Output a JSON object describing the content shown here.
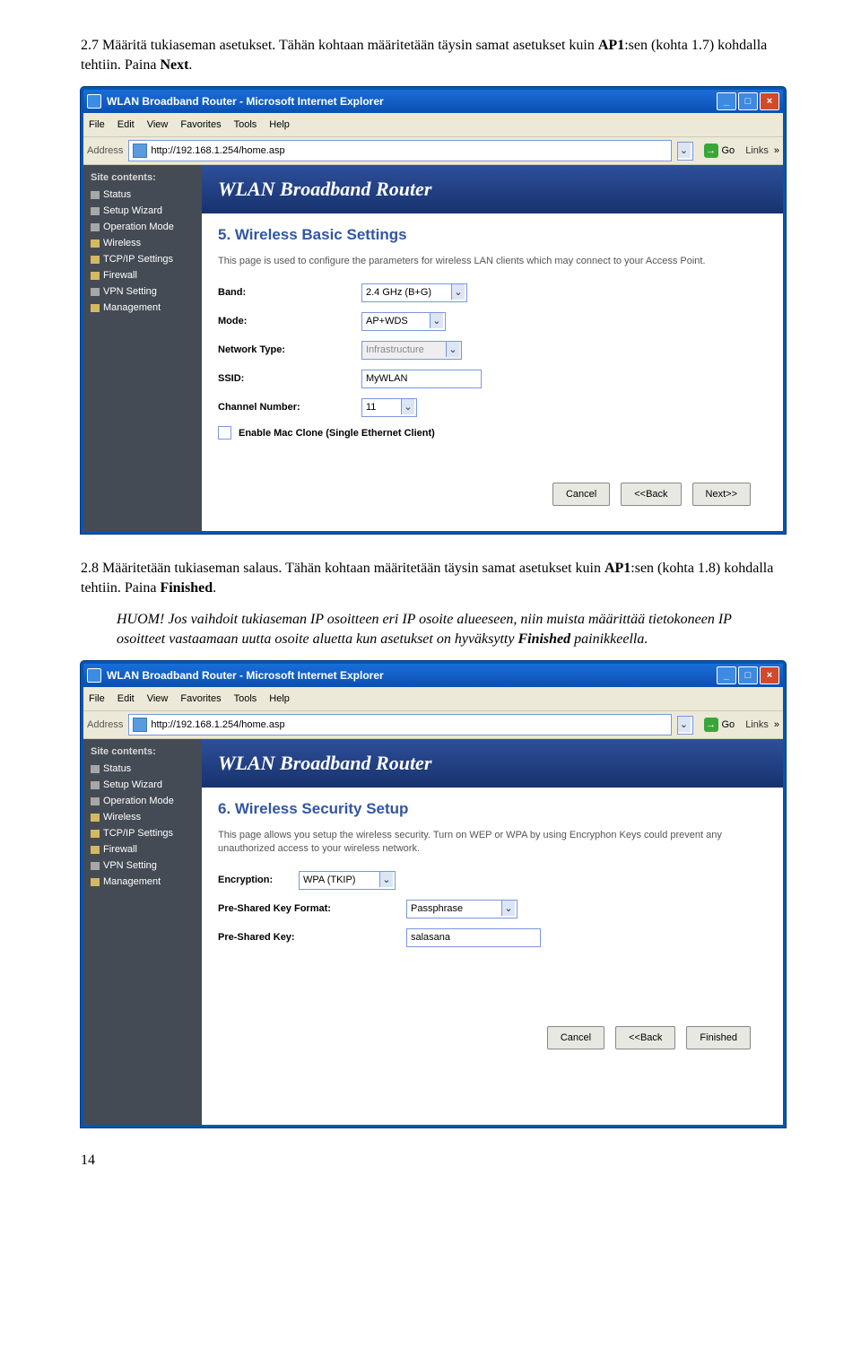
{
  "doc": {
    "para1": {
      "lead": "2.7 Määritä tukiaseman asetukset. Tähän kohtaan määritetään täysin samat asetukset kuin ",
      "bold1": "AP1",
      "mid": ":sen (kohta 1.7) kohdalla tehtiin. Paina ",
      "bold2": "Next",
      "tail": "."
    },
    "para2": {
      "lead": "2.8 Määritetään tukiaseman salaus. Tähän kohtaan määritetään täysin samat asetukset kuin ",
      "bold1": "AP1",
      "mid": ":sen (kohta 1.8) kohdalla tehtiin. Paina ",
      "bold2": "Finished",
      "tail": "."
    },
    "note": {
      "lead": "HUOM! Jos vaihdoit tukiaseman IP osoitteen eri IP osoite alueeseen, niin muista määrittää tietokoneen IP osoitteet vastaamaan uutta osoite aluetta kun asetukset on hyväksytty ",
      "bold": "Finished",
      "tail": " painikkeella."
    },
    "page_number": "14"
  },
  "ie": {
    "title": "WLAN Broadband Router - Microsoft Internet Explorer",
    "menu": [
      "File",
      "Edit",
      "View",
      "Favorites",
      "Tools",
      "Help"
    ],
    "address_label": "Address",
    "address_value": "http://192.168.1.254/home.asp",
    "go": "Go",
    "links": "Links"
  },
  "router": {
    "banner": "WLAN Broadband Router",
    "sidebar": [
      "Site contents:",
      "Status",
      "Setup Wizard",
      "Operation Mode",
      "Wireless",
      "TCP/IP Settings",
      "Firewall",
      "VPN Setting",
      "Management"
    ]
  },
  "screen1": {
    "title": "5. Wireless Basic Settings",
    "desc": "This page is used to configure the parameters for wireless LAN clients which may connect to your Access Point.",
    "rows": {
      "band": {
        "label": "Band:",
        "value": "2.4 GHz (B+G)"
      },
      "mode": {
        "label": "Mode:",
        "value": "AP+WDS"
      },
      "nettype": {
        "label": "Network Type:",
        "value": "Infrastructure"
      },
      "ssid": {
        "label": "SSID:",
        "value": "MyWLAN"
      },
      "chan": {
        "label": "Channel Number:",
        "value": "11"
      }
    },
    "mac_clone": "Enable Mac Clone (Single Ethernet Client)",
    "buttons": [
      "Cancel",
      "<<Back",
      "Next>>"
    ]
  },
  "screen2": {
    "title": "6. Wireless Security Setup",
    "desc": "This page allows you setup the wireless security. Turn on WEP or WPA by using Encryphon Keys could prevent any unauthorized access to your wireless network.",
    "rows": {
      "enc": {
        "label": "Encryption:",
        "value": "WPA (TKIP)"
      },
      "pskf": {
        "label": "Pre-Shared Key Format:",
        "value": "Passphrase"
      },
      "psk": {
        "label": "Pre-Shared Key:",
        "value": "salasana"
      }
    },
    "buttons": [
      "Cancel",
      "<<Back",
      "Finished"
    ]
  }
}
